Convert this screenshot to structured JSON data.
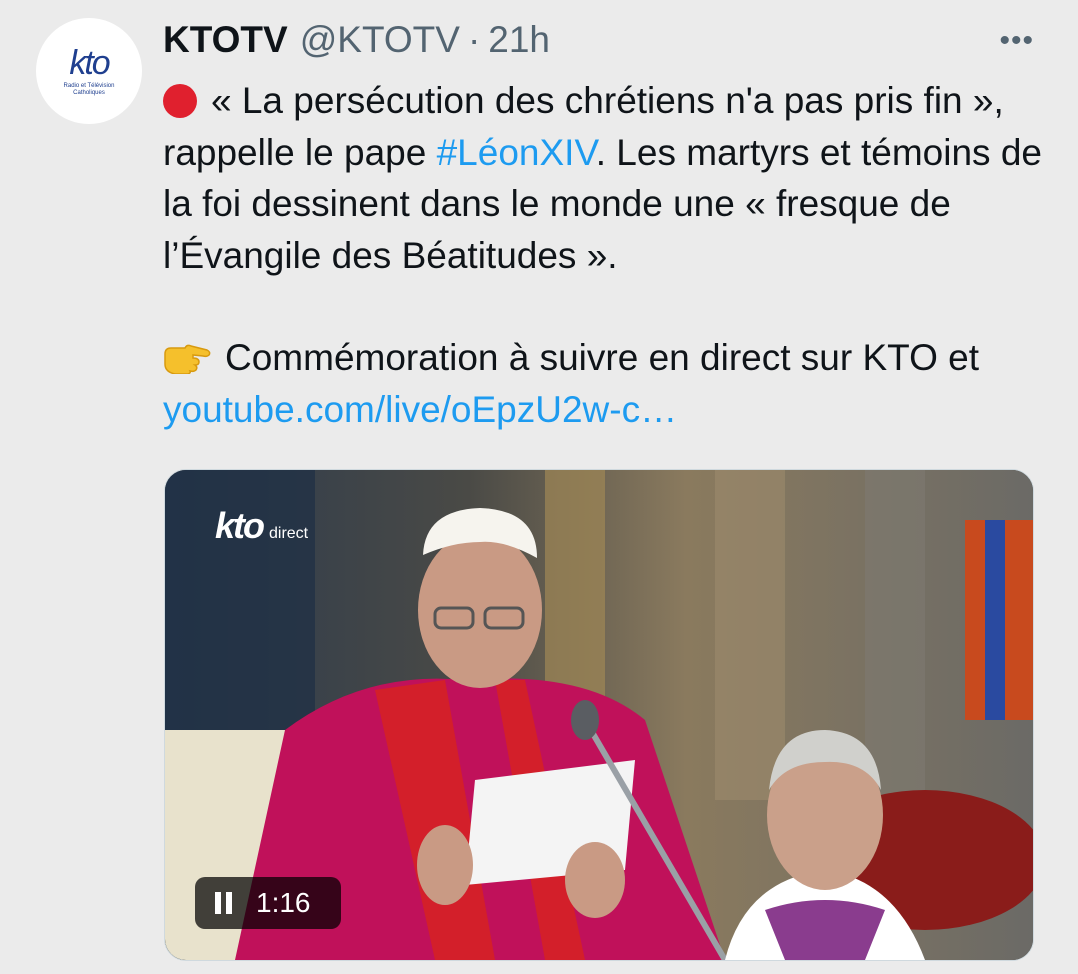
{
  "avatar": {
    "logo_text": "kto",
    "logo_subtitle": "Radio et Télévision Catholiques"
  },
  "tweet": {
    "author_name": "KTOTV",
    "author_handle": "@KTOTV",
    "separator": "·",
    "time": "21h",
    "more_label": "•••",
    "paragraph1_pre": "« La persécution des chrétiens n'a pas pris fin », rappelle le pape ",
    "hashtag": "#LéonXIV",
    "paragraph1_post": ". Les martyrs et témoins de la foi dessinent dans le monde une « fresque de l’Évangile des Béatitudes ».",
    "paragraph2_text": "Commémoration à suivre en direct sur KTO et ",
    "link": "youtube.com/live/oEpzU2w-c…"
  },
  "media": {
    "watermark_logo": "kto",
    "watermark_label": "direct",
    "video_time": "1:16"
  },
  "icons": {
    "status": "red-circle-emoji",
    "pointer": "backhand-index-pointing-right-emoji",
    "video": "pause-icon"
  },
  "colors": {
    "background": "#ebebeb",
    "text": "#0f1419",
    "secondary": "#536471",
    "link": "#1d9bf0",
    "brand": "#1f3f8f"
  }
}
